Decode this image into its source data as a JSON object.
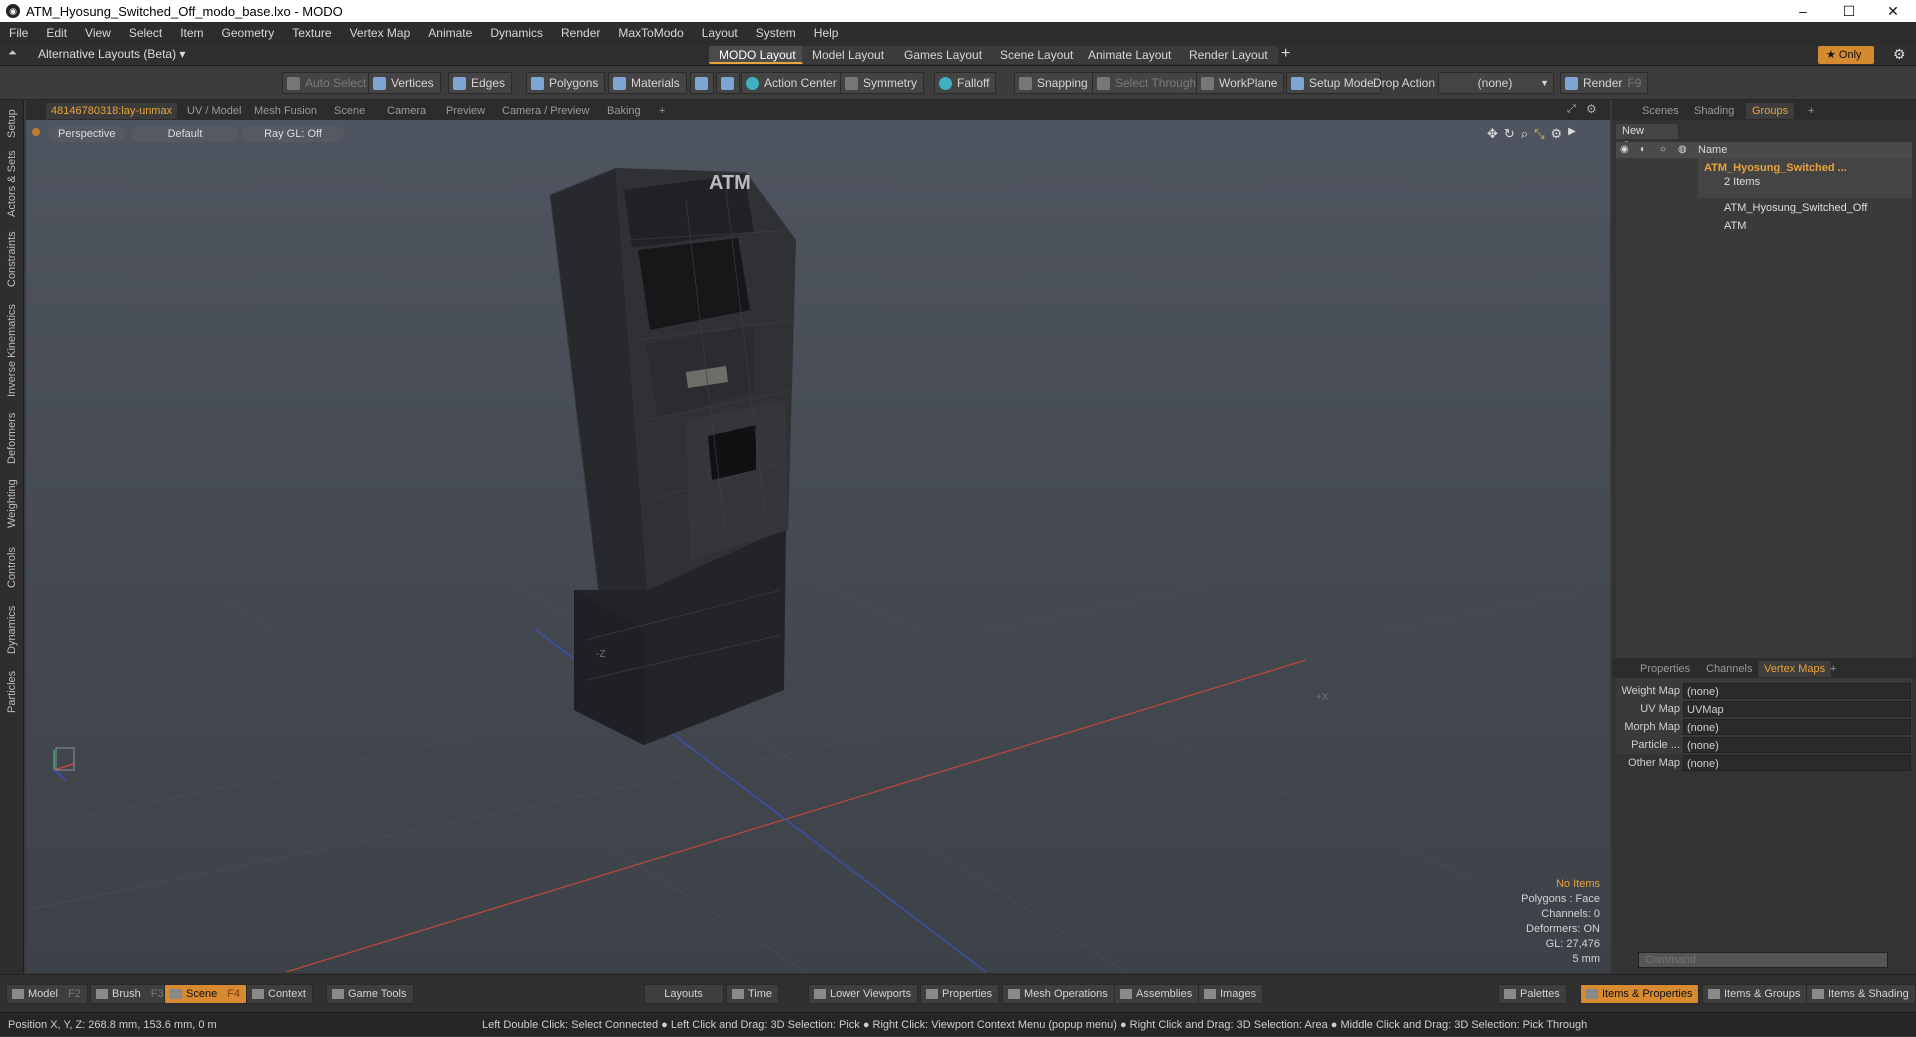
{
  "window": {
    "title": "ATM_Hyosung_Switched_Off_modo_base.lxo - MODO",
    "minimize": "–",
    "maximize": "☐",
    "close": "✕"
  },
  "menu": [
    "File",
    "Edit",
    "View",
    "Select",
    "Item",
    "Geometry",
    "Texture",
    "Vertex Map",
    "Animate",
    "Dynamics",
    "Render",
    "MaxToModo",
    "Layout",
    "System",
    "Help"
  ],
  "layoutbar": {
    "alt_layouts": "Alternative Layouts (Beta) ▾",
    "tabs": [
      "MODO Layout",
      "Model Layout",
      "Games Layout",
      "Scene Layout",
      "Animate Layout",
      "Render Layout"
    ],
    "add": "+",
    "only": "Only"
  },
  "toolbar": {
    "auto_select": "Auto Select",
    "vertices": "Vertices",
    "edges": "Edges",
    "polygons": "Polygons",
    "materials": "Materials",
    "action_center": "Action Center",
    "symmetry": "Symmetry",
    "falloff": "Falloff",
    "snapping": "Snapping",
    "select_through": "Select Through",
    "workplane": "WorkPlane",
    "setup_mode": "Setup Mode",
    "drop_action": "Drop Action",
    "drop_value": "(none)",
    "render": "Render",
    "render_key": "F9"
  },
  "left_tabs": [
    "Setup",
    "Actors & Sets",
    "Constraints",
    "Inverse Kinematics",
    "Deformers",
    "Weighting",
    "Controls",
    "Dynamics",
    "Particles"
  ],
  "viewport_tabs": [
    "48146780318:lay-unmax",
    "UV / Model",
    "Mesh Fusion",
    "Scene",
    "Camera",
    "Preview",
    "Camera / Preview",
    "Baking",
    "+"
  ],
  "viewport": {
    "perspective": "Perspective",
    "default": "Default",
    "raygl": "Ray GL: Off",
    "atm_label": "ATM",
    "axis_x": "+X",
    "axis_z": "-Z",
    "info": {
      "items": "No Items",
      "polygons": "Polygons : Face",
      "channels": "Channels: 0",
      "deformers": "Deformers: ON",
      "gl": "GL: 27,476",
      "scale": "5 mm"
    }
  },
  "right_panel": {
    "tabs": [
      "Scenes",
      "Shading",
      "Groups",
      "+"
    ],
    "new_group": "New Group",
    "name_header": "Name",
    "group_name": "ATM_Hyosung_Switched ...",
    "group_count": "2 Items",
    "children": [
      "ATM_Hyosung_Switched_Off",
      "ATM"
    ],
    "prop_tabs": [
      "Properties",
      "Channels",
      "Vertex Maps",
      "+"
    ],
    "vertex_maps": [
      {
        "label": "Weight Map",
        "value": "(none)"
      },
      {
        "label": "UV Map",
        "value": "UVMap"
      },
      {
        "label": "Morph Map",
        "value": "(none)"
      },
      {
        "label": "Particle ...",
        "value": "(none)"
      },
      {
        "label": "Other Map",
        "value": "(none)"
      }
    ],
    "command_placeholder": "Command"
  },
  "bottombar": {
    "model": "Model",
    "model_key": "F2",
    "brush": "Brush",
    "brush_key": "F3",
    "scene": "Scene",
    "scene_key": "F4",
    "context": "Context",
    "game_tools": "Game Tools",
    "layouts": "Layouts",
    "time": "Time",
    "lower_viewports": "Lower Viewports",
    "properties": "Properties",
    "mesh_operations": "Mesh Operations",
    "assemblies": "Assemblies",
    "images": "Images",
    "palettes": "Palettes",
    "items_properties": "Items & Properties",
    "items_groups": "Items & Groups",
    "items_shading": "Items & Shading"
  },
  "status": {
    "position": "Position X, Y, Z:   268.8 mm, 153.6 mm, 0 m",
    "hint": "Left Double Click: Select Connected ● Left Click and Drag: 3D Selection: Pick ● Right Click: Viewport Context Menu (popup menu) ● Right Click and Drag: 3D Selection: Area ● Middle Click and Drag: 3D Selection: Pick Through"
  }
}
